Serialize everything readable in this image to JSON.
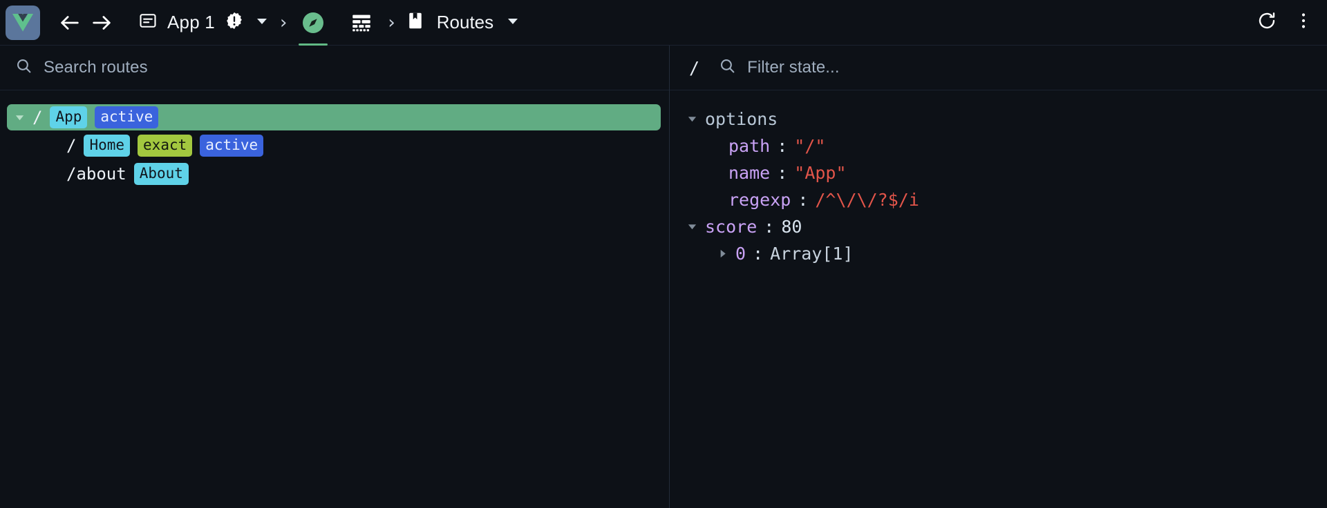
{
  "toolbar": {
    "logo_name": "vue-logo",
    "back_label": "Back",
    "forward_label": "Forward",
    "app_icon": "window-icon",
    "app_label": "App 1",
    "warning_icon": "warning-badge-icon",
    "app_dropdown_icon": "chevron-down-icon",
    "separator": "›",
    "tabs": [
      {
        "name": "routes-tab",
        "icon": "compass-icon",
        "active": true
      },
      {
        "name": "timeline-tab",
        "icon": "layers-list-icon",
        "active": false
      }
    ],
    "routes_icon": "bookmark-icon",
    "routes_label": "Routes",
    "routes_dropdown_icon": "chevron-down-icon",
    "refresh_icon": "refresh-icon",
    "more_icon": "more-vertical-icon"
  },
  "left_pane": {
    "search": {
      "icon": "search-icon",
      "placeholder": "Search routes",
      "value": ""
    },
    "routes": [
      {
        "path": "/",
        "selected": true,
        "expandable": true,
        "expanded": true,
        "indent": 0,
        "badges": [
          {
            "text": "App",
            "type": "name"
          },
          {
            "text": "active",
            "type": "active"
          }
        ]
      },
      {
        "path": "/",
        "selected": false,
        "expandable": false,
        "expanded": false,
        "indent": 1,
        "badges": [
          {
            "text": "Home",
            "type": "name"
          },
          {
            "text": "exact",
            "type": "exact"
          },
          {
            "text": "active",
            "type": "active"
          }
        ]
      },
      {
        "path": "/about",
        "selected": false,
        "expandable": false,
        "expanded": false,
        "indent": 1,
        "badges": [
          {
            "text": "About",
            "type": "name"
          }
        ]
      }
    ]
  },
  "right_pane": {
    "filter": {
      "prefix": "/",
      "icon": "search-icon",
      "placeholder": "Filter state...",
      "value": ""
    },
    "state": [
      {
        "level": 1,
        "caret": "expanded",
        "key": "options",
        "key_style": "root",
        "colon": "",
        "value": "",
        "value_style": "none"
      },
      {
        "level": 2,
        "caret": "none",
        "key": "path",
        "key_style": "key",
        "colon": ":",
        "value": "\"/\"",
        "value_style": "string"
      },
      {
        "level": 2,
        "caret": "none",
        "key": "name",
        "key_style": "key",
        "colon": ":",
        "value": "\"App\"",
        "value_style": "string"
      },
      {
        "level": 2,
        "caret": "none",
        "key": "regexp",
        "key_style": "key",
        "colon": ":",
        "value": "/^\\/\\/?$/i",
        "value_style": "string"
      },
      {
        "level": 1,
        "caret": "expanded",
        "key": "score",
        "key_style": "key",
        "colon": ":",
        "value": "80",
        "value_style": "number"
      },
      {
        "level": 3,
        "caret": "collapsed",
        "key": "0",
        "key_style": "key",
        "colon": ":",
        "value": "Array[1]",
        "value_style": "object"
      }
    ]
  },
  "colors": {
    "background": "#0d1117",
    "selected_row": "#61ac83",
    "badge_name": "#5fd2e8",
    "badge_active": "#3a63dd",
    "badge_exact": "#a3c83f",
    "accent_green": "#62ba85",
    "string_value": "#e2554a",
    "key_purple": "#c9a2f5"
  }
}
